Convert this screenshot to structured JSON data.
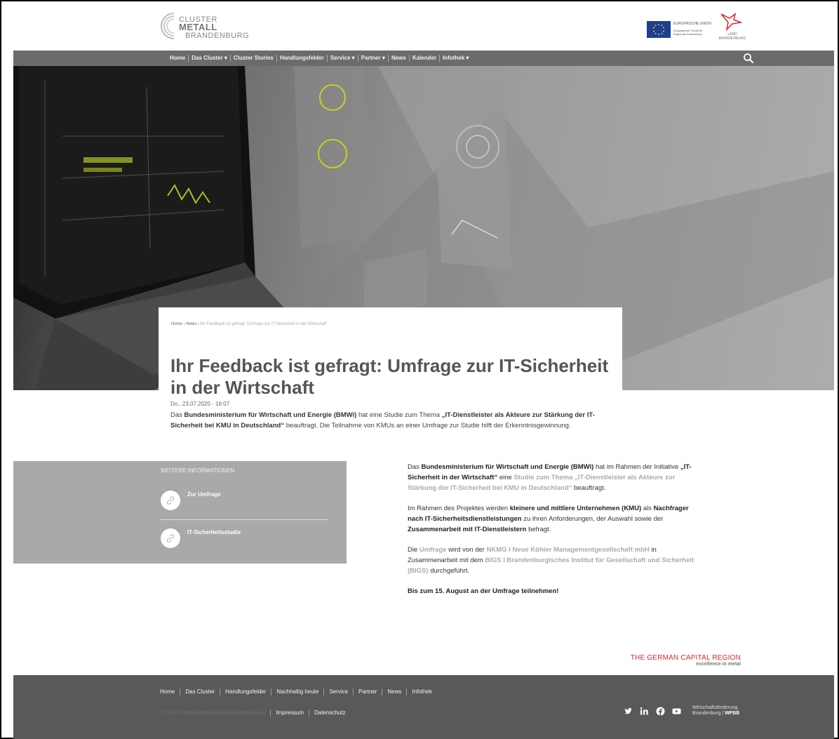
{
  "header": {
    "logo_lines": [
      "CLUSTER",
      "METALL",
      "BRANDENBURG"
    ],
    "eu_title": "EUROPÄISCHE UNION",
    "eu_fund": "Europäischer Fonds für Regionale Entwicklung",
    "state_name": "LAND BRANDENBURG"
  },
  "nav": {
    "items": [
      "Home",
      "Das Cluster ▾",
      "Cluster Stories",
      "Handlungsfelder",
      "Service ▾",
      "Partner ▾",
      "News",
      "Kalender",
      "Infothek ▾"
    ]
  },
  "breadcrumb": {
    "items": [
      "Home",
      "News"
    ],
    "separator": "›",
    "current": "Ihr Feedback ist gefragt: Umfrage zur IT-Sicherheit in der Wirtschaft"
  },
  "article": {
    "title": "Ihr Feedback ist gefragt: Umfrage zur IT-Sicherheit in der Wirtschaft",
    "date": "Do., 23.07.2020 - 16:07",
    "lead": {
      "t1": "Das ",
      "b1": "Bundesministerium für Wirtschaft und Energie (BMWi)",
      "t2": " hat eine Studie zum Thema ",
      "b2": "„IT-Dienstleister als Akteure zur Stärkung der IT-Sicherheit bei KMU in Deutschland“",
      "t3": " beauftragt. Die Teilnahme von KMUs an einer Umfrage zur Studie hilft der Erkenntnisgewinnung."
    },
    "p1": {
      "t1": "Das ",
      "b1": "Bundesministerium für Wirtschaft und Energie (BMWi)",
      "t2": " hat im Rahmen der Initiative ",
      "b2": "„IT-Sicherheit in der Wirtschaft“",
      "t3": " eine ",
      "l1": "Studie zum Thema „IT-Dienstleister als Akteure zur Stärkung der IT-Sicherheit bei KMU in Deutschland“",
      "t4": " beauftragt."
    },
    "p2": {
      "t1": "Im Rahmen des Projektes werden ",
      "b1": "kleinere und mittlere Unternehmen (KMU)",
      "t2": " als ",
      "b2": "Nachfrager nach IT-Sicherheitsdienstleistungen",
      "t3": " zu ihren Anforderungen, der Auswahl sowie der ",
      "b3": "Zusammenarbeit mit IT-Dienstleistern",
      "t4": " befragt."
    },
    "p3": {
      "t1": "Die ",
      "l1": "Umfrage",
      "t2": " wird von der ",
      "l2": "NKMG I Neue Köhler Managementgesellschaft mbH",
      "t3": " in Zusammenarbeit mit dem ",
      "l3": "BIGS I Brandenburgisches Institut für Gesellschaft und Sicherheit (BIGS)",
      "t4": " durchgeführt."
    },
    "p4": "Bis zum 15. August an der Umfrage teilnehmen!"
  },
  "sidebar": {
    "title": "WEITERE INFORMATIONEN",
    "links": [
      "Zur Umfrage",
      "IT-Sicherheitsstudie"
    ]
  },
  "region": {
    "title": "THE GERMAN CAPITAL REGION",
    "subtitle": "excellence in metal"
  },
  "footer": {
    "nav": [
      "Home",
      "Das Cluster",
      "Handlungsfelder",
      "Nachhaltig heute",
      "Service",
      "Partner",
      "News",
      "Infothek"
    ],
    "copyright": "© 2020 Wirtschaftsförderung Brandenburg",
    "impressum": "Impressum",
    "datenschutz": "Datenschutz",
    "wfbb_line1": "Wirtschaftsförderung",
    "wfbb_line2": "Brandenburg",
    "wfbb_short": "WFBB"
  },
  "colors": {
    "nav_bg": "#6b6b6b",
    "footer_bg": "#595959",
    "sidebar_bg": "#a9a9a9",
    "region_red": "#d6272f"
  }
}
